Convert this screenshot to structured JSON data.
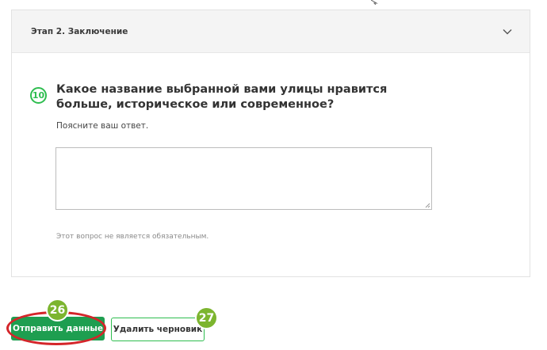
{
  "section": {
    "title": "Этап 2. Заключение"
  },
  "question": {
    "number": "10",
    "title": "Какое название выбранной вами улицы нравится больше, историческое или современное?",
    "hint": "Поясните ваш ответ.",
    "answer_value": "",
    "optional_note": "Этот вопрос не является обязательным."
  },
  "actions": {
    "submit_label": "Отправить данные",
    "delete_draft_label": "Удалить черновик"
  },
  "annotations": {
    "submit_marker": "26",
    "draft_marker": "27"
  },
  "colors": {
    "accent_green": "#2ebd4f",
    "submit_green": "#1e9e50",
    "marker_green": "#7cb52f",
    "highlight_red": "#d4252a"
  },
  "icons": {
    "section_toggle": "chevron-down-icon",
    "resize": "resize-grip-icon",
    "cursor": "mouse-cursor-icon"
  }
}
